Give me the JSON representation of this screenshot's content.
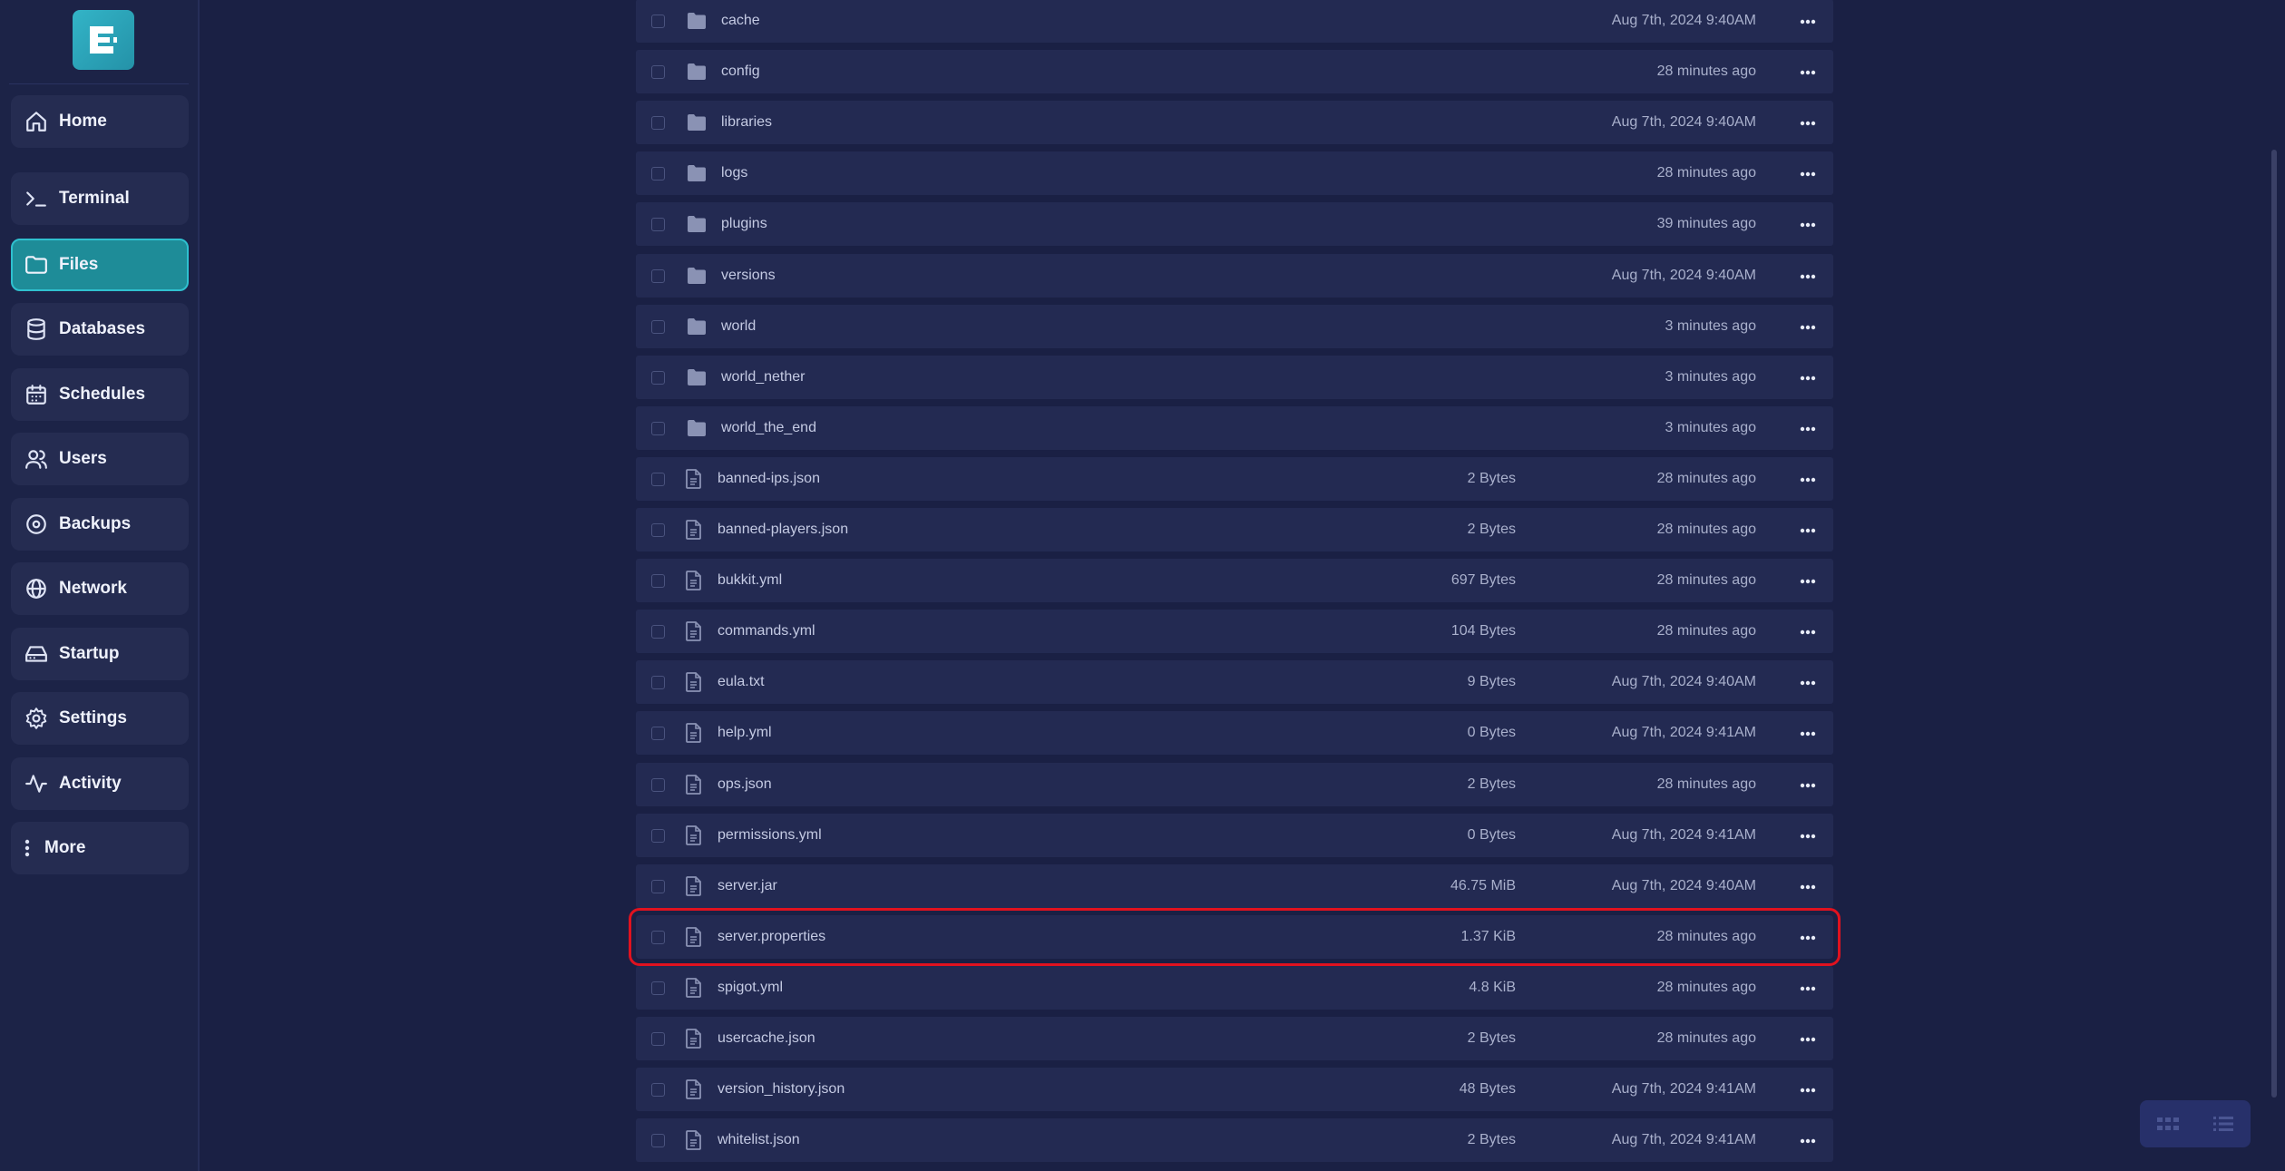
{
  "sidebar": {
    "items": [
      {
        "label": "Home",
        "icon": "home-icon"
      },
      {
        "label": "Terminal",
        "icon": "terminal-icon"
      },
      {
        "label": "Files",
        "icon": "folder-icon",
        "active": true
      },
      {
        "label": "Databases",
        "icon": "database-icon"
      },
      {
        "label": "Schedules",
        "icon": "calendar-icon"
      },
      {
        "label": "Users",
        "icon": "users-icon"
      },
      {
        "label": "Backups",
        "icon": "backup-icon"
      },
      {
        "label": "Network",
        "icon": "globe-icon"
      },
      {
        "label": "Startup",
        "icon": "drive-icon"
      },
      {
        "label": "Settings",
        "icon": "gear-icon"
      },
      {
        "label": "Activity",
        "icon": "activity-icon"
      },
      {
        "label": "More",
        "icon": "more-vertical-icon"
      }
    ]
  },
  "files": [
    {
      "name": "cache",
      "type": "folder",
      "size": "",
      "modified": "Aug 7th, 2024 9:40AM"
    },
    {
      "name": "config",
      "type": "folder",
      "size": "",
      "modified": "28 minutes ago"
    },
    {
      "name": "libraries",
      "type": "folder",
      "size": "",
      "modified": "Aug 7th, 2024 9:40AM"
    },
    {
      "name": "logs",
      "type": "folder",
      "size": "",
      "modified": "28 minutes ago"
    },
    {
      "name": "plugins",
      "type": "folder",
      "size": "",
      "modified": "39 minutes ago"
    },
    {
      "name": "versions",
      "type": "folder",
      "size": "",
      "modified": "Aug 7th, 2024 9:40AM"
    },
    {
      "name": "world",
      "type": "folder",
      "size": "",
      "modified": "3 minutes ago"
    },
    {
      "name": "world_nether",
      "type": "folder",
      "size": "",
      "modified": "3 minutes ago"
    },
    {
      "name": "world_the_end",
      "type": "folder",
      "size": "",
      "modified": "3 minutes ago"
    },
    {
      "name": "banned-ips.json",
      "type": "file",
      "size": "2 Bytes",
      "modified": "28 minutes ago"
    },
    {
      "name": "banned-players.json",
      "type": "file",
      "size": "2 Bytes",
      "modified": "28 minutes ago"
    },
    {
      "name": "bukkit.yml",
      "type": "file",
      "size": "697 Bytes",
      "modified": "28 minutes ago"
    },
    {
      "name": "commands.yml",
      "type": "file",
      "size": "104 Bytes",
      "modified": "28 minutes ago"
    },
    {
      "name": "eula.txt",
      "type": "file",
      "size": "9 Bytes",
      "modified": "Aug 7th, 2024 9:40AM"
    },
    {
      "name": "help.yml",
      "type": "file",
      "size": "0 Bytes",
      "modified": "Aug 7th, 2024 9:41AM"
    },
    {
      "name": "ops.json",
      "type": "file",
      "size": "2 Bytes",
      "modified": "28 minutes ago"
    },
    {
      "name": "permissions.yml",
      "type": "file",
      "size": "0 Bytes",
      "modified": "Aug 7th, 2024 9:41AM"
    },
    {
      "name": "server.jar",
      "type": "file",
      "size": "46.75 MiB",
      "modified": "Aug 7th, 2024 9:40AM"
    },
    {
      "name": "server.properties",
      "type": "file",
      "size": "1.37 KiB",
      "modified": "28 minutes ago",
      "highlighted": true
    },
    {
      "name": "spigot.yml",
      "type": "file",
      "size": "4.8 KiB",
      "modified": "28 minutes ago"
    },
    {
      "name": "usercache.json",
      "type": "file",
      "size": "2 Bytes",
      "modified": "28 minutes ago"
    },
    {
      "name": "version_history.json",
      "type": "file",
      "size": "48 Bytes",
      "modified": "Aug 7th, 2024 9:41AM"
    },
    {
      "name": "whitelist.json",
      "type": "file",
      "size": "2 Bytes",
      "modified": "Aug 7th, 2024 9:41AM"
    }
  ],
  "colors": {
    "accent": "#1e8c98",
    "highlight": "#e0121f",
    "background": "#1a2044"
  }
}
